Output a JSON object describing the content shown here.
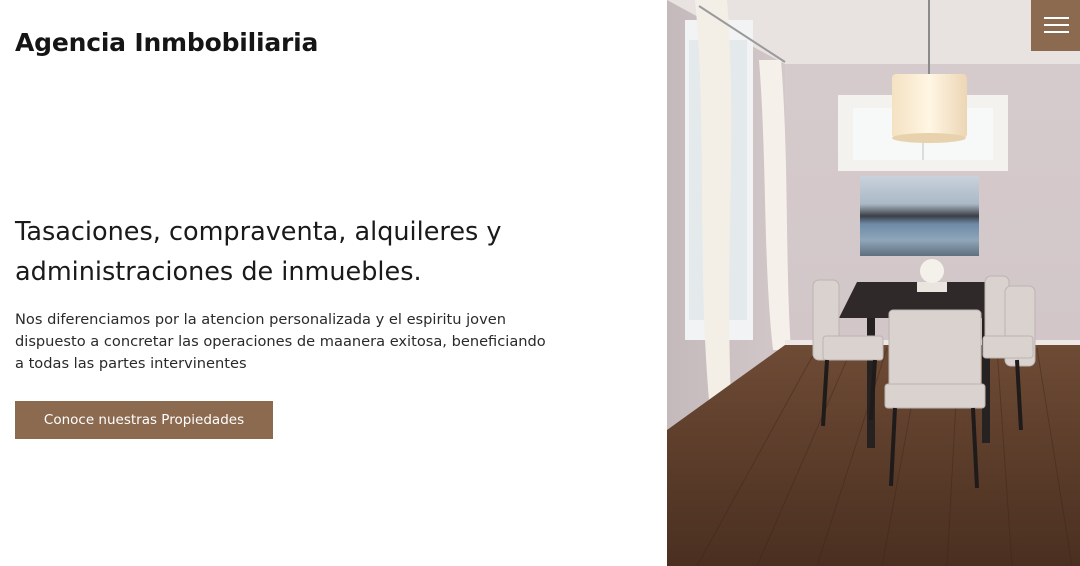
{
  "brand": {
    "name": "Agencia Inmbobiliaria"
  },
  "hero": {
    "headline": "Tasaciones, compraventa, alquileres y administraciones de inmuebles.",
    "description": "Nos diferenciamos por la atencion personalizada y el espiritu joven dispuesto a concretar las operaciones de maanera exitosa, beneficiando a todas las partes intervinentes",
    "cta_label": "Conoce nuestras Propiedades",
    "image_subject": "dining-room-photo"
  },
  "nav": {
    "menu_icon": "hamburger-menu-icon"
  },
  "colors": {
    "accent": "#8b6a4f",
    "background": "#ffffff",
    "text": "#1a1a1a"
  }
}
